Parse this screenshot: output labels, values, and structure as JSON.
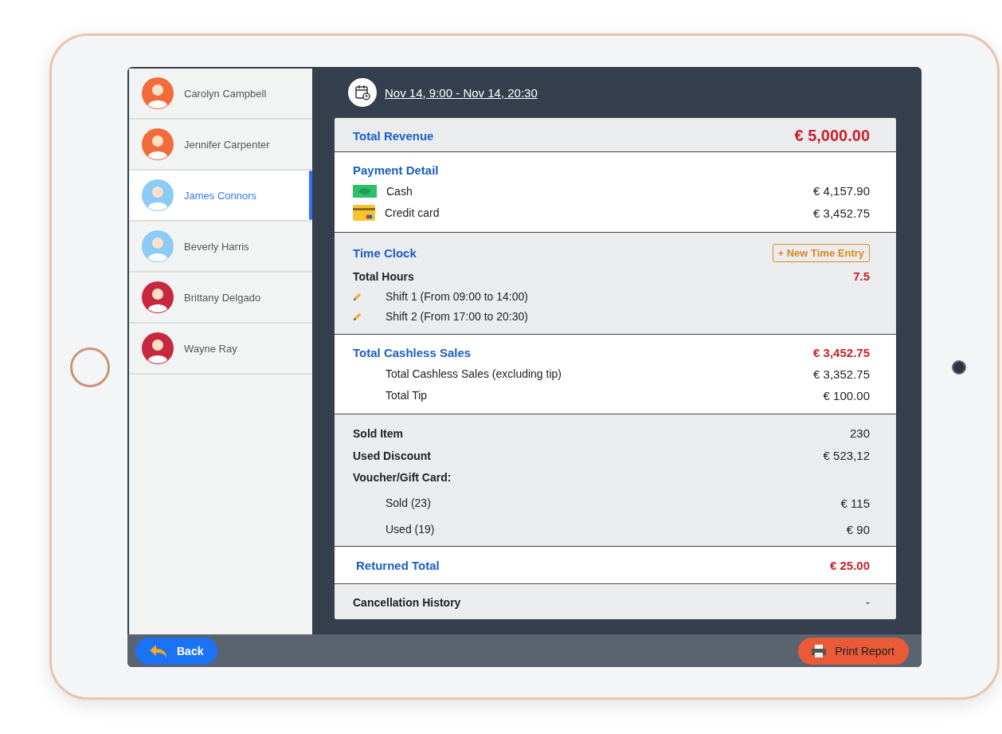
{
  "staff": [
    {
      "name": "Carolyn Campbell",
      "selected": false,
      "color": "#f26b3a"
    },
    {
      "name": "Jennifer Carpenter",
      "selected": false,
      "color": "#f26b3a"
    },
    {
      "name": "James Connors",
      "selected": true,
      "color": "#8ccbf5"
    },
    {
      "name": "Beverly Harris",
      "selected": false,
      "color": "#8ccbf5"
    },
    {
      "name": "Brittany Delgado",
      "selected": false,
      "color": "#c8283f"
    },
    {
      "name": "Wayne Ray",
      "selected": false,
      "color": "#c8283f"
    }
  ],
  "date_range": "Nov 14, 9:00 - Nov 14, 20:30",
  "total_revenue": {
    "label": "Total Revenue",
    "value": "€ 5,000.00"
  },
  "payment_detail": {
    "title": "Payment Detail",
    "methods": [
      {
        "kind": "cash",
        "label": "Cash",
        "value": "€ 4,157.90"
      },
      {
        "kind": "card",
        "label": "Credit card",
        "value": "€ 3,452.75"
      }
    ]
  },
  "time_clock": {
    "title": "Time Clock",
    "button": "+ New Time Entry",
    "total_label": "Total Hours",
    "total_value": "7.5",
    "shifts": [
      "Shift 1 (From 09:00 to 14:00)",
      "Shift 2 (From 17:00 to 20:30)"
    ]
  },
  "cashless": {
    "title": "Total Cashless Sales",
    "value": "€ 3,452.75",
    "rows": [
      {
        "label": "Total Cashless Sales (excluding tip)",
        "value": "€ 3,352.75"
      },
      {
        "label": "Total Tip",
        "value": "€ 100.00"
      }
    ]
  },
  "summary": {
    "rows": [
      {
        "label": "Sold Item",
        "value": "230"
      },
      {
        "label": "Used Discount",
        "value": "€ 523,12"
      }
    ],
    "voucher": {
      "label": "Voucher/Gift Card:",
      "rows": [
        {
          "label": "Sold (23)",
          "value": "€ 115"
        },
        {
          "label": "Used (19)",
          "value": "€ 90"
        }
      ]
    }
  },
  "returned": {
    "label": "Returned Total",
    "value": "€ 25.00"
  },
  "cancellation": {
    "label": "Cancellation History",
    "value": "-"
  },
  "footer": {
    "back": "Back",
    "print": "Print Report"
  }
}
